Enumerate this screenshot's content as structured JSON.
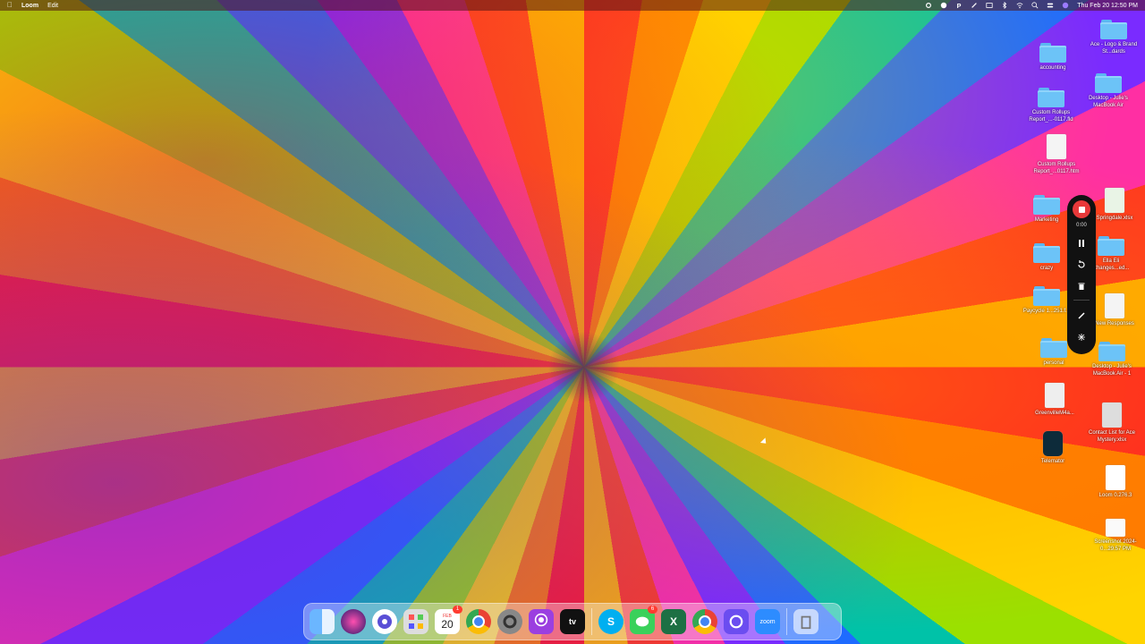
{
  "menubar": {
    "app_name": "Loom",
    "menu_edit": "Edit",
    "datetime": "Thu Feb 20  12:50 PM",
    "status_icons": [
      "gear-icon",
      "loom-icon",
      "p-icon",
      "pen-icon",
      "bluetooth-icon",
      "wifi-icon",
      "search-icon",
      "control-center-icon"
    ]
  },
  "desktop_icons": [
    {
      "label": "accounting",
      "kind": "folder"
    },
    {
      "label": "Custom Rollups Report_...-0117.fld",
      "kind": "folder"
    },
    {
      "label": "Custom Rollups Report_...0117.htm",
      "kind": "doc"
    },
    {
      "label": "Marketing",
      "kind": "folder"
    },
    {
      "label": "crazy",
      "kind": "folder"
    },
    {
      "label": "Paycycle 1...251.f...",
      "kind": "folder"
    },
    {
      "label": "personal",
      "kind": "folder"
    },
    {
      "label": "GreenvilleM4a...",
      "kind": "audio"
    },
    {
      "label": "Telemator",
      "kind": "app"
    },
    {
      "label": "Ace - Logo & Brand St...dards",
      "kind": "folder"
    },
    {
      "label": "Desktop - Julie's MacBook Air",
      "kind": "folder"
    },
    {
      "label": "Springdale.xlsx",
      "kind": "sheet"
    },
    {
      "label": "Ella Eli Changes...ed...",
      "kind": "folder"
    },
    {
      "label": "New Responses",
      "kind": "doc"
    },
    {
      "label": "Desktop - Julie's MacBook Air - 1",
      "kind": "folder"
    },
    {
      "label": "Contact List for Ace Mystery.xlsx",
      "kind": "doc"
    },
    {
      "label": "Loom 0.276.3",
      "kind": "app"
    },
    {
      "label": "Screenshot 2024-0...29.57 PM",
      "kind": "doc"
    }
  ],
  "loom_control": {
    "timer": "0:00"
  },
  "dock": {
    "calendar_month": "FEB",
    "calendar_day": "20",
    "calendar_badge": "1",
    "messages_badge": "6",
    "appletv_label": "tv",
    "skype_label": "S",
    "excel_label": "X",
    "zoom_label": "zoom"
  }
}
